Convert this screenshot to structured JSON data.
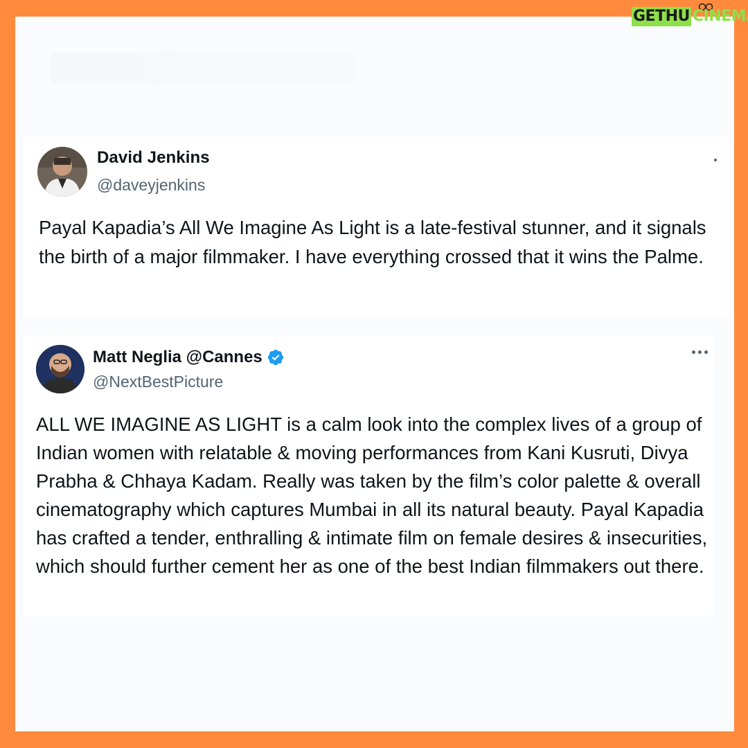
{
  "colors": {
    "frame": "#ff8a3d",
    "card": "#fafbfc",
    "text": "#0f1419",
    "muted": "#536471",
    "verified": "#1d9bf0",
    "logo_green": "#8ee04a"
  },
  "logo": {
    "part1": "GETHU",
    "part2": "CINEMA",
    "icon": "film-reel-icon"
  },
  "tweets": [
    {
      "name": "David Jenkins",
      "handle": "@daveyjenkins",
      "verified": false,
      "avatar_icon": "user-avatar",
      "more_icon": "more-options-icon",
      "text": "Payal Kapadia’s All We Imagine As Light is a late-festival stunner, and it signals the birth of a major filmmaker. I have everything crossed that it wins the Palme."
    },
    {
      "name": "Matt Neglia @Cannes",
      "handle": "@NextBestPicture",
      "verified": true,
      "avatar_icon": "user-avatar",
      "more_icon": "more-options-icon",
      "text": "ALL WE IMAGINE AS LIGHT is a calm look into the complex lives of a group of Indian women with relatable & moving performances from Kani Kusruti, Divya Prabha & Chhaya Kadam. Really was taken by the film’s color palette & overall cinematography which captures Mumbai in all its natural beauty. Payal Kapadia has crafted a tender, enthralling & intimate film on female desires & insecurities, which should further cement her as one of the best Indian filmmakers out there."
    }
  ]
}
